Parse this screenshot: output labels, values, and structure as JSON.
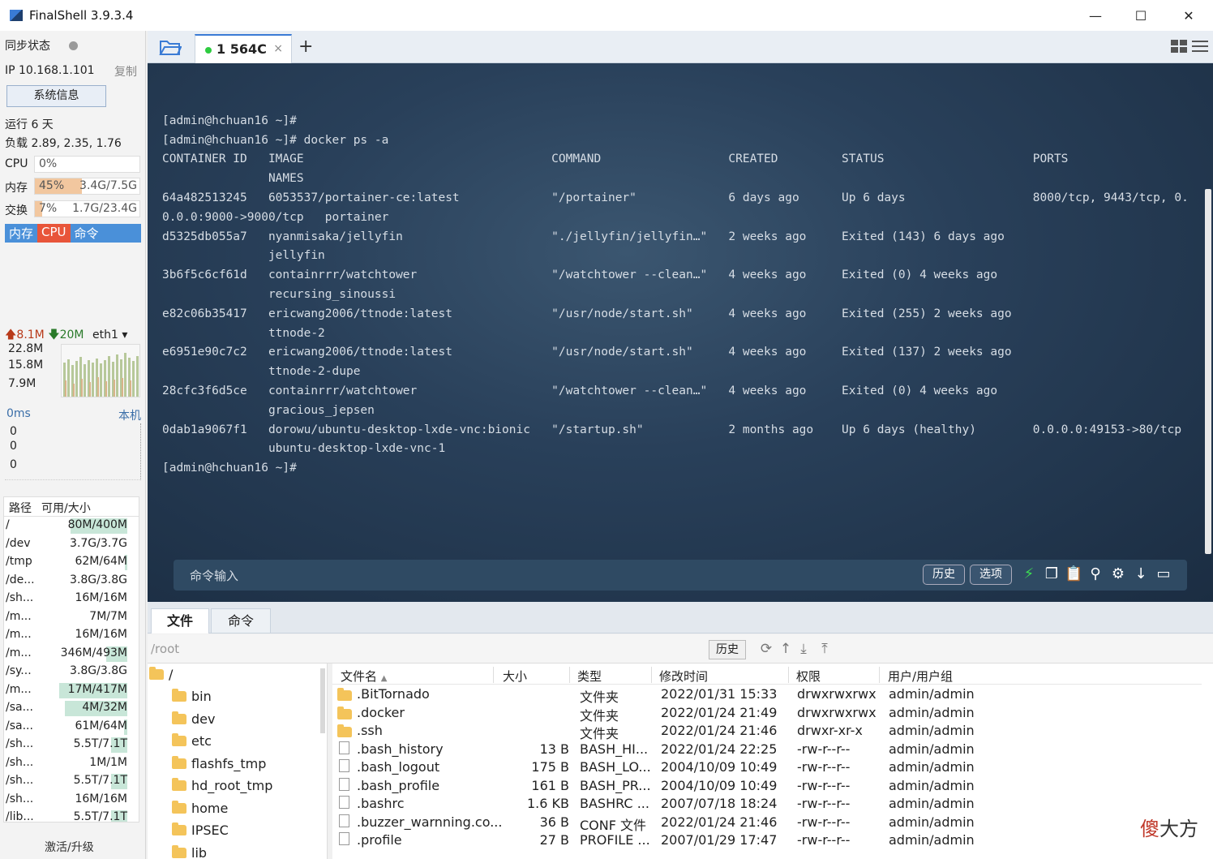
{
  "window": {
    "title": "FinalShell 3.9.3.4",
    "min": "—",
    "max": "☐",
    "close": "✕"
  },
  "sidebar": {
    "sync_label": "同步状态",
    "ip": "IP 10.168.1.101",
    "copy": "复制",
    "sysinfo_btn": "系统信息",
    "uptime": "运行 6 天",
    "load": "负载 2.89, 2.35, 1.76",
    "cpu": {
      "label": "CPU",
      "pct": "0%",
      "fill": 0.0
    },
    "mem": {
      "label": "内存",
      "pct": "45%",
      "value": "3.4G/7.5G",
      "fill": 0.45
    },
    "swap": {
      "label": "交换",
      "pct": "7%",
      "value": "1.7G/23.4G",
      "fill": 0.07
    },
    "mini_tabs": [
      "内存",
      "CPU",
      "命令"
    ],
    "net": {
      "up": "8.1M",
      "down": "20M",
      "iface": "eth1",
      "scale": [
        "22.8M",
        "15.8M",
        "7.9M"
      ]
    },
    "ping": {
      "label": "0ms",
      "host": "本机",
      "values": [
        "0",
        "0",
        "0"
      ]
    },
    "disk": {
      "headers": [
        "路径",
        "可用/大小"
      ],
      "rows": [
        {
          "path": "/",
          "value": "80M/400M",
          "used": 0.8
        },
        {
          "path": "/dev",
          "value": "3.7G/3.7G",
          "used": 0.0
        },
        {
          "path": "/tmp",
          "value": "62M/64M",
          "used": 0.03
        },
        {
          "path": "/de...",
          "value": "3.8G/3.8G",
          "used": 0.0
        },
        {
          "path": "/sh...",
          "value": "16M/16M",
          "used": 0.0
        },
        {
          "path": "/m...",
          "value": "7M/7M",
          "used": 0.0
        },
        {
          "path": "/m...",
          "value": "16M/16M",
          "used": 0.0
        },
        {
          "path": "/m...",
          "value": "346M/493M",
          "used": 0.3
        },
        {
          "path": "/sy...",
          "value": "3.8G/3.8G",
          "used": 0.0
        },
        {
          "path": "/m...",
          "value": "17M/417M",
          "used": 0.96
        },
        {
          "path": "/sa...",
          "value": "4M/32M",
          "used": 0.88
        },
        {
          "path": "/sa...",
          "value": "61M/64M",
          "used": 0.05
        },
        {
          "path": "/sh...",
          "value": "5.5T/7.1T",
          "used": 0.23
        },
        {
          "path": "/sh...",
          "value": "1M/1M",
          "used": 0.0
        },
        {
          "path": "/sh...",
          "value": "5.5T/7.1T",
          "used": 0.23
        },
        {
          "path": "/sh...",
          "value": "16M/16M",
          "used": 0.0
        },
        {
          "path": "/lib...",
          "value": "5.5T/7.1T",
          "used": 0.23
        }
      ]
    },
    "activate": "激活/升级"
  },
  "session_tab": {
    "label": "1 564C",
    "close": "×",
    "add": "+"
  },
  "terminal": {
    "lines": [
      "",
      "[admin@hchuan16 ~]#",
      "[admin@hchuan16 ~]# docker ps -a",
      "CONTAINER ID   IMAGE                                   COMMAND                  CREATED         STATUS                     PORTS",
      "               NAMES",
      "64a482513245   6053537/portainer-ce:latest             \"/portainer\"             6 days ago      Up 6 days                  8000/tcp, 9443/tcp, 0.",
      "0.0.0:9000->9000/tcp   portainer",
      "d5325db055a7   nyanmisaka/jellyfin                     \"./jellyfin/jellyfin…\"   2 weeks ago     Exited (143) 6 days ago",
      "               jellyfin",
      "3b6f5c6cf61d   containrrr/watchtower                   \"/watchtower --clean…\"   4 weeks ago     Exited (0) 4 weeks ago",
      "               recursing_sinoussi",
      "e82c06b35417   ericwang2006/ttnode:latest              \"/usr/node/start.sh\"     4 weeks ago     Exited (255) 2 weeks ago",
      "               ttnode-2",
      "e6951e90c7c2   ericwang2006/ttnode:latest              \"/usr/node/start.sh\"     4 weeks ago     Exited (137) 2 weeks ago",
      "               ttnode-2-dupe",
      "28cfc3f6d5ce   containrrr/watchtower                   \"/watchtower --clean…\"   4 weeks ago     Exited (0) 4 weeks ago",
      "               gracious_jepsen",
      "0dab1a9067f1   dorowu/ubuntu-desktop-lxde-vnc:bionic   \"/startup.sh\"            2 months ago    Up 6 days (healthy)        0.0.0.0:49153->80/tcp",
      "               ubuntu-desktop-lxde-vnc-1",
      "[admin@hchuan16 ~]#"
    ],
    "cmd_placeholder": "命令输入",
    "history_btn": "历史",
    "options_btn": "选项"
  },
  "bottom": {
    "tabs": [
      "文件",
      "命令"
    ],
    "path": "/root",
    "history_btn": "历史",
    "tree": [
      "/",
      "bin",
      "dev",
      "etc",
      "flashfs_tmp",
      "hd_root_tmp",
      "home",
      "IPSEC",
      "lib"
    ],
    "file_headers": [
      "文件名",
      "大小",
      "类型",
      "修改时间",
      "权限",
      "用户/用户组"
    ],
    "files": [
      {
        "name": ".BitTornado",
        "size": "",
        "type": "文件夹",
        "mtime": "2022/01/31 15:33",
        "perm": "drwxrwxrwx",
        "owner": "admin/admin",
        "dir": true
      },
      {
        "name": ".docker",
        "size": "",
        "type": "文件夹",
        "mtime": "2022/01/24 21:49",
        "perm": "drwxrwxrwx",
        "owner": "admin/admin",
        "dir": true
      },
      {
        "name": ".ssh",
        "size": "",
        "type": "文件夹",
        "mtime": "2022/01/24 21:46",
        "perm": "drwxr-xr-x",
        "owner": "admin/admin",
        "dir": true
      },
      {
        "name": ".bash_history",
        "size": "13 B",
        "type": "BASH_HI...",
        "mtime": "2022/01/24 22:25",
        "perm": "-rw-r--r--",
        "owner": "admin/admin",
        "dir": false
      },
      {
        "name": ".bash_logout",
        "size": "175 B",
        "type": "BASH_LO...",
        "mtime": "2004/10/09 10:49",
        "perm": "-rw-r--r--",
        "owner": "admin/admin",
        "dir": false
      },
      {
        "name": ".bash_profile",
        "size": "161 B",
        "type": "BASH_PR...",
        "mtime": "2004/10/09 10:49",
        "perm": "-rw-r--r--",
        "owner": "admin/admin",
        "dir": false
      },
      {
        "name": ".bashrc",
        "size": "1.6 KB",
        "type": "BASHRC ...",
        "mtime": "2007/07/18 18:24",
        "perm": "-rw-r--r--",
        "owner": "admin/admin",
        "dir": false
      },
      {
        "name": ".buzzer_warnning.co...",
        "size": "36 B",
        "type": "CONF 文件",
        "mtime": "2022/01/24 21:46",
        "perm": "-rw-r--r--",
        "owner": "admin/admin",
        "dir": false
      },
      {
        "name": ".profile",
        "size": "27 B",
        "type": "PROFILE ...",
        "mtime": "2007/01/29 17:47",
        "perm": "-rw-r--r--",
        "owner": "admin/admin",
        "dir": false
      }
    ]
  },
  "watermark": {
    "red": "傻",
    "rest": "大方"
  }
}
